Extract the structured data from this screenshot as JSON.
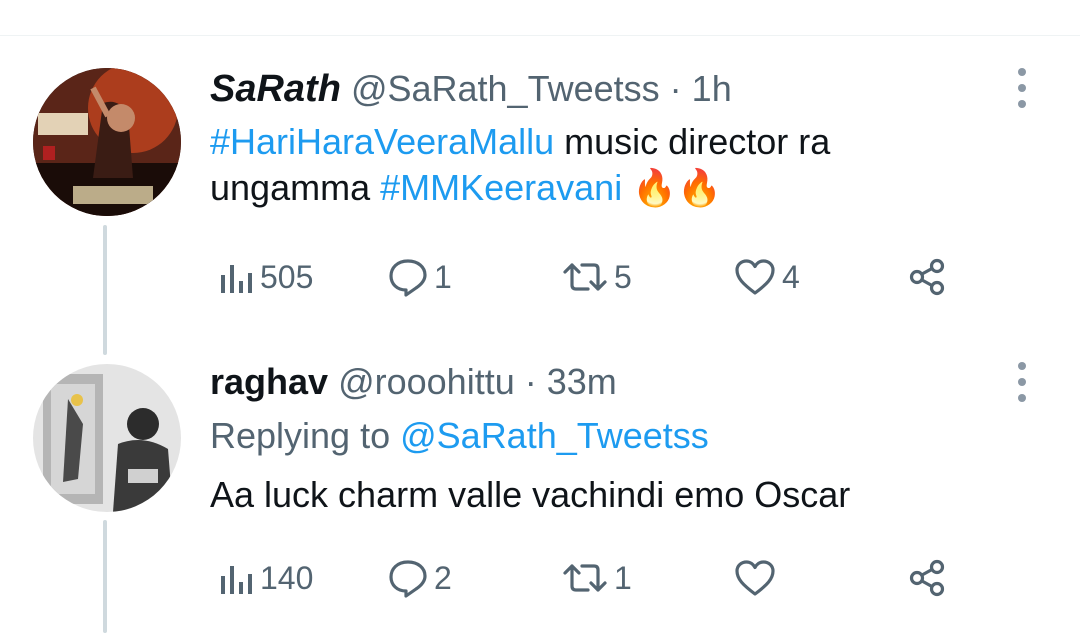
{
  "tweets": [
    {
      "display_name": "SaRath",
      "handle": "@SaRath_Tweetss",
      "separator": "·",
      "time": "1h",
      "text_parts": [
        {
          "type": "hashtag",
          "text": "#HariHaraVeeraMallu"
        },
        {
          "type": "text",
          "text": " music director ra ungamma "
        },
        {
          "type": "hashtag",
          "text": "#MMKeeravani"
        },
        {
          "type": "text",
          "text": " 🔥🔥"
        }
      ],
      "stats": {
        "views": "505",
        "replies": "1",
        "retweets": "5",
        "likes": "4"
      },
      "icons": {
        "views": "views-icon",
        "reply": "reply-icon",
        "retweet": "retweet-icon",
        "like": "like-icon",
        "share": "share-icon",
        "more": "more-icon"
      }
    },
    {
      "display_name": "raghav",
      "handle": "@rooohittu",
      "separator": "·",
      "time": "33m",
      "replying_label": "Replying to ",
      "replying_to": "@SaRath_Tweetss",
      "text": "Aa luck charm valle vachindi emo Oscar",
      "stats": {
        "views": "140",
        "replies": "2",
        "retweets": "1",
        "likes": ""
      },
      "icons": {
        "views": "views-icon",
        "reply": "reply-icon",
        "retweet": "retweet-icon",
        "like": "like-icon",
        "share": "share-icon",
        "more": "more-icon"
      }
    }
  ],
  "colors": {
    "link": "#1d9bf0",
    "muted": "#536471",
    "thread_line": "#cfd9de"
  }
}
